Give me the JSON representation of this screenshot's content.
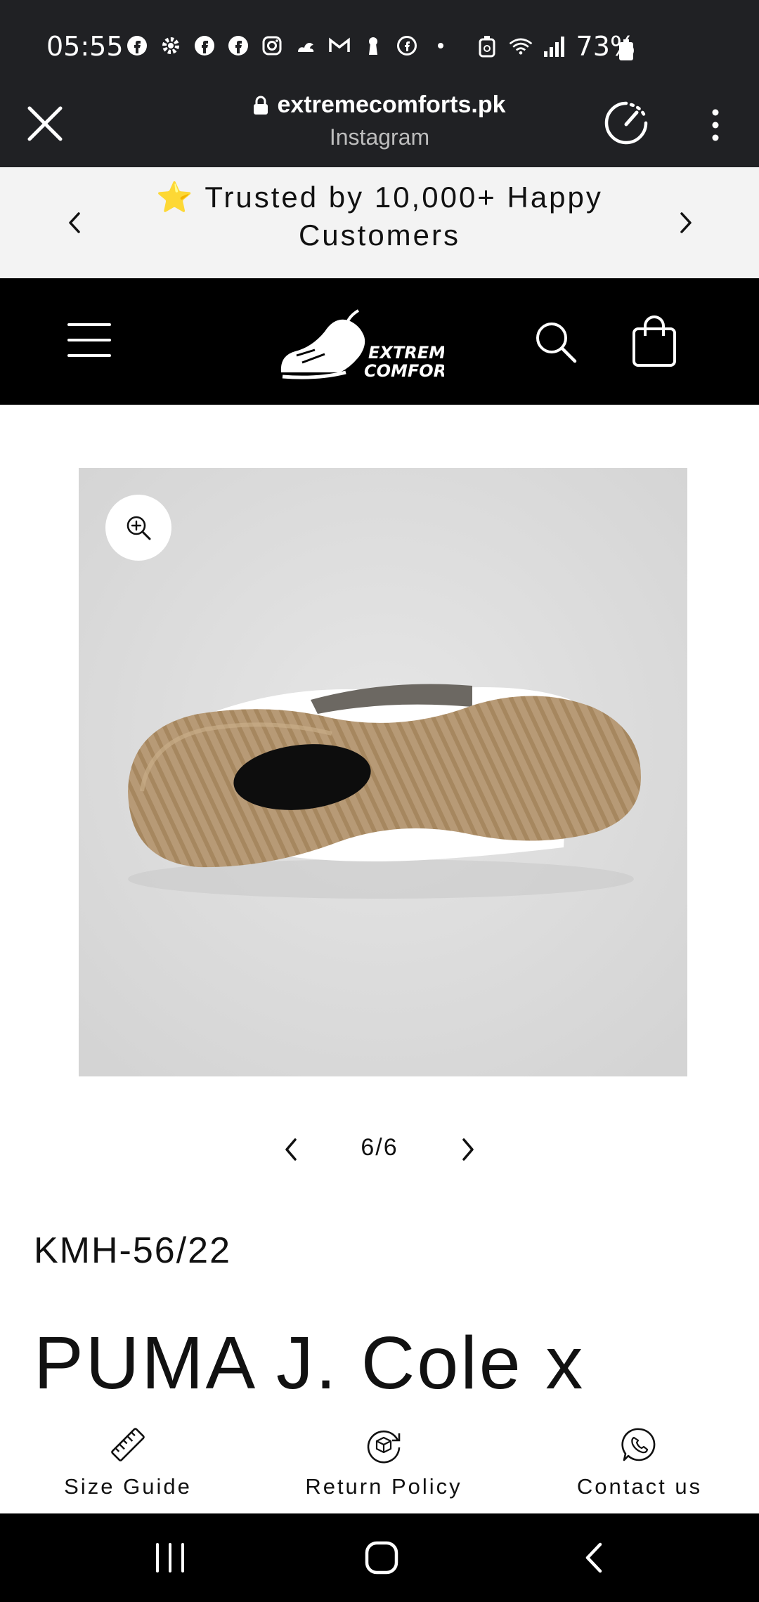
{
  "status_bar": {
    "time": "05:55",
    "battery": "73%",
    "notification_icons": [
      "facebook-icon",
      "gear-icon",
      "facebook-icon",
      "facebook-icon",
      "instagram-icon",
      "cloud-icon",
      "gmail-icon",
      "keyhole-icon",
      "facebook-lite-icon",
      "dot-icon"
    ],
    "system_icons": [
      "recycle-icon",
      "wifi-icon",
      "signal-icon",
      "battery-icon"
    ]
  },
  "browser": {
    "url": "extremecomforts.pk",
    "source": "Instagram"
  },
  "announcement": {
    "emoji": "⭐",
    "text": "Trusted by 10,000+ Happy Customers"
  },
  "header": {
    "logo_line1": "EXTREME",
    "logo_line2": "COMFORTS"
  },
  "product": {
    "slide_counter": "6/6",
    "sku": "KMH-56/22",
    "title": "PUMA J. Cole x"
  },
  "bottom_bar": {
    "items": [
      {
        "label": "Size Guide",
        "icon": "ruler-icon"
      },
      {
        "label": "Return Policy",
        "icon": "return-box-icon"
      },
      {
        "label": "Contact us",
        "icon": "whatsapp-icon"
      }
    ]
  },
  "colors": {
    "status_bg": "#202124",
    "announce_bg": "#f3f3f3",
    "header_bg": "#000000",
    "image_bg": "#dedede",
    "sole": "#b79a76",
    "text": "#111111"
  }
}
